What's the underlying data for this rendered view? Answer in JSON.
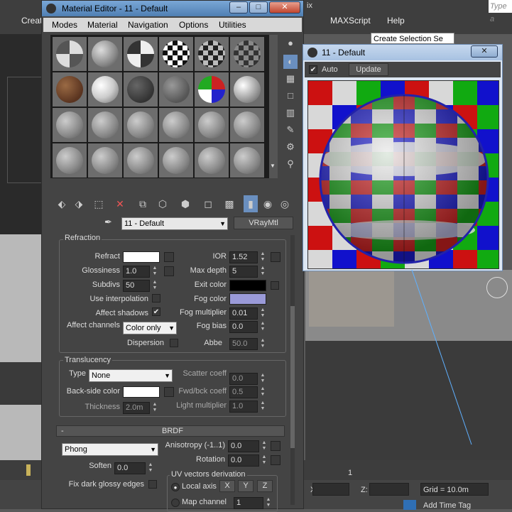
{
  "max": {
    "menu": {
      "create_partial": "Creat",
      "maxscript": "MAXScript",
      "help": "Help"
    },
    "search_placeholder": "Type a",
    "selection_set": "Create Selection Se",
    "x_label": "X:",
    "z_label": "Z:",
    "grid": "Grid = 10.0m",
    "add_time_tag": "Add Time Tag",
    "timeline_tick": "1",
    "title_partial": "ix"
  },
  "material_editor": {
    "title": "Material Editor - 11 - Default",
    "menu": [
      "Modes",
      "Material",
      "Navigation",
      "Options",
      "Utilities"
    ],
    "material_name": "11 - Default",
    "material_type": "VRayMtl",
    "refraction": {
      "title": "Refraction",
      "refract_label": "Refract",
      "ior_label": "IOR",
      "ior_value": "1.52",
      "glossiness_label": "Glossiness",
      "glossiness_value": "1.0",
      "max_depth_label": "Max depth",
      "max_depth_value": "5",
      "subdivs_label": "Subdivs",
      "subdivs_value": "50",
      "exit_color_label": "Exit color",
      "use_interpolation_label": "Use interpolation",
      "fog_color_label": "Fog color",
      "affect_shadows_label": "Affect shadows",
      "affect_shadows_checked": "✔",
      "fog_multiplier_label": "Fog multiplier",
      "fog_multiplier_value": "0.01",
      "affect_channels_label": "Affect channels",
      "affect_channels_value": "Color only",
      "fog_bias_label": "Fog bias",
      "fog_bias_value": "0.0",
      "dispersion_label": "Dispersion",
      "abbe_label": "Abbe",
      "abbe_value": "50.0"
    },
    "translucency": {
      "title": "Translucency",
      "type_label": "Type",
      "type_value": "None",
      "scatter_coeff_label": "Scatter coeff",
      "scatter_coeff_value": "0.0",
      "back_side_color_label": "Back-side color",
      "fwd_bck_coeff_label": "Fwd/bck coeff",
      "fwd_bck_coeff_value": "0.5",
      "thickness_label": "Thickness",
      "thickness_value": "2.0m",
      "light_multiplier_label": "Light multiplier",
      "light_multiplier_value": "1.0"
    },
    "brdf": {
      "collapse": "-",
      "title": "BRDF",
      "type_value": "Phong",
      "anisotropy_label": "Anisotropy (-1..1)",
      "anisotropy_value": "0.0",
      "rotation_label": "Rotation",
      "rotation_value": "0.0",
      "soften_label": "Soften",
      "soften_value": "0.0",
      "uv_title": "UV vectors derivation",
      "local_axis_label": "Local axis",
      "axis_x": "X",
      "axis_y": "Y",
      "axis_z": "Z",
      "fix_dark_label": "Fix dark glossy edges",
      "map_channel_label": "Map channel",
      "map_channel_value": "1"
    }
  },
  "preview": {
    "title": "11 - Default",
    "auto_label": "Auto",
    "auto_checked": "✔",
    "update_label": "Update"
  },
  "colors": {
    "refract": "#ffffff",
    "exit": "#000000",
    "fog": "#9a9ad8",
    "back_side": "#ffffff",
    "title_bar": "#5b8cc2"
  }
}
